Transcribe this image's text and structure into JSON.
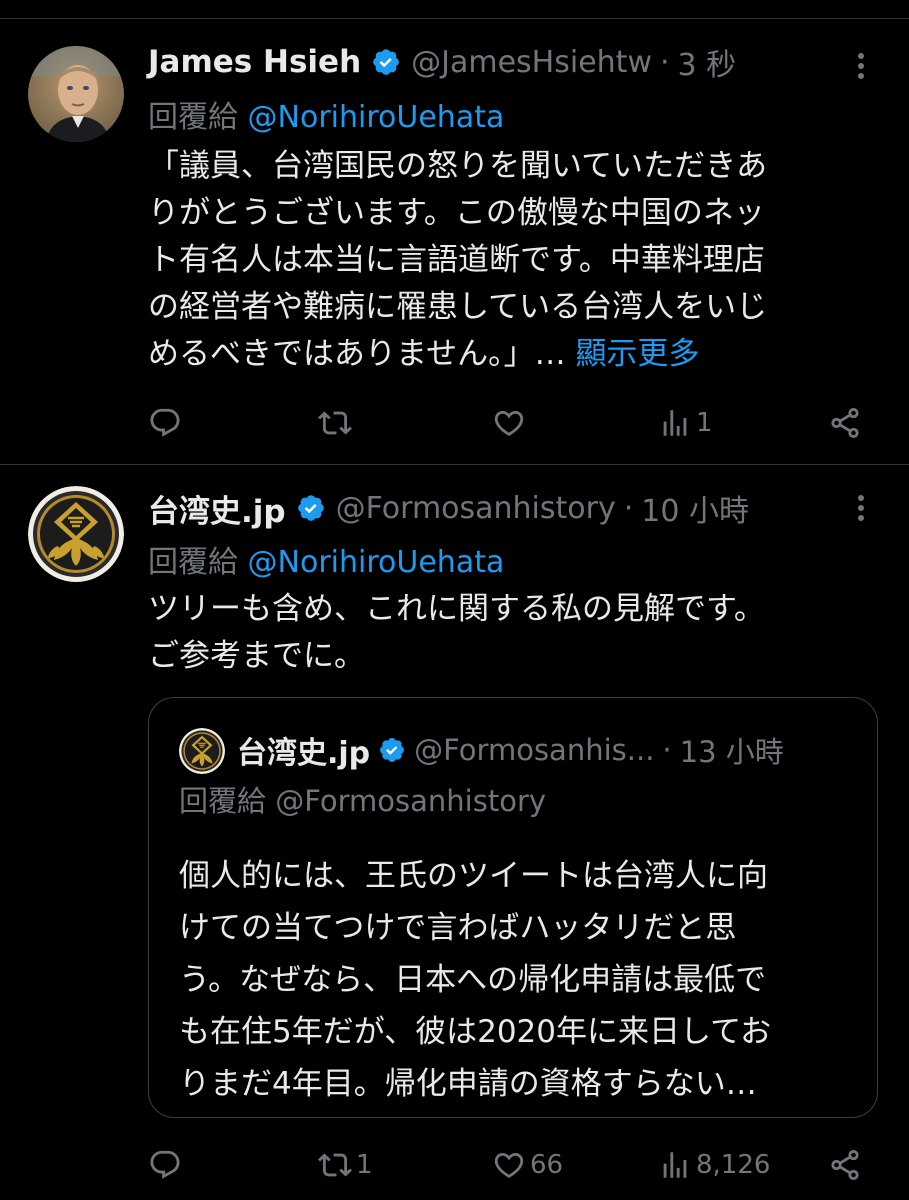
{
  "colors": {
    "background": "#000000",
    "text": "#e7e9ea",
    "muted": "#71767b",
    "link": "#1d9bf0",
    "divider": "#2f3336",
    "verified": "#1d9bf0"
  },
  "tweets": [
    {
      "display_name": "James Hsieh",
      "handle": "@JamesHsiehtw",
      "separator": "·",
      "time": "3 秒",
      "reply_prefix": "回覆給",
      "reply_to": "@NorihiroUehata",
      "body_lines": [
        "「議員、台湾国民の怒りを聞いていただきあ",
        "りがとうございます。この傲慢な中国のネッ",
        "ト有名人は本当に言語道断です。中華料理店",
        "の経営者や難病に罹患している台湾人をいじ",
        "めるべきではありません。」…"
      ],
      "show_more": "顯示更多",
      "actions": {
        "reply_icon": "reply-icon",
        "retweet_icon": "retweet-icon",
        "retweet_count": "",
        "like_icon": "heart-icon",
        "like_count": "",
        "views_icon": "views-icon",
        "views_count": "1",
        "share_icon": "share-icon"
      }
    },
    {
      "display_name": "台湾史.jp",
      "handle": "@Formosanhistory",
      "separator": "·",
      "time": "10 小時",
      "reply_prefix": "回覆給",
      "reply_to": "@NorihiroUehata",
      "body_lines": [
        "ツリーも含め、これに関する私の見解です。",
        "ご参考までに。"
      ],
      "quote": {
        "display_name": "台湾史.jp",
        "handle": "@Formosanhis...",
        "separator": "·",
        "time": "13 小時",
        "reply_prefix": "回覆給",
        "reply_to": "@Formosanhistory",
        "body_lines": [
          "個人的には、王氏のツイートは台湾人に向",
          "けての当てつけで言わばハッタリだと思",
          "う。なぜなら、日本への帰化申請は最低で",
          "も在住5年だが、彼は2020年に来日してお",
          "りまだ4年目。帰化申請の資格すらない…"
        ]
      },
      "actions": {
        "reply_icon": "reply-icon",
        "retweet_icon": "retweet-icon",
        "retweet_count": "1",
        "like_icon": "heart-icon",
        "like_count": "66",
        "views_icon": "views-icon",
        "views_count": "8,126",
        "share_icon": "share-icon"
      }
    }
  ]
}
